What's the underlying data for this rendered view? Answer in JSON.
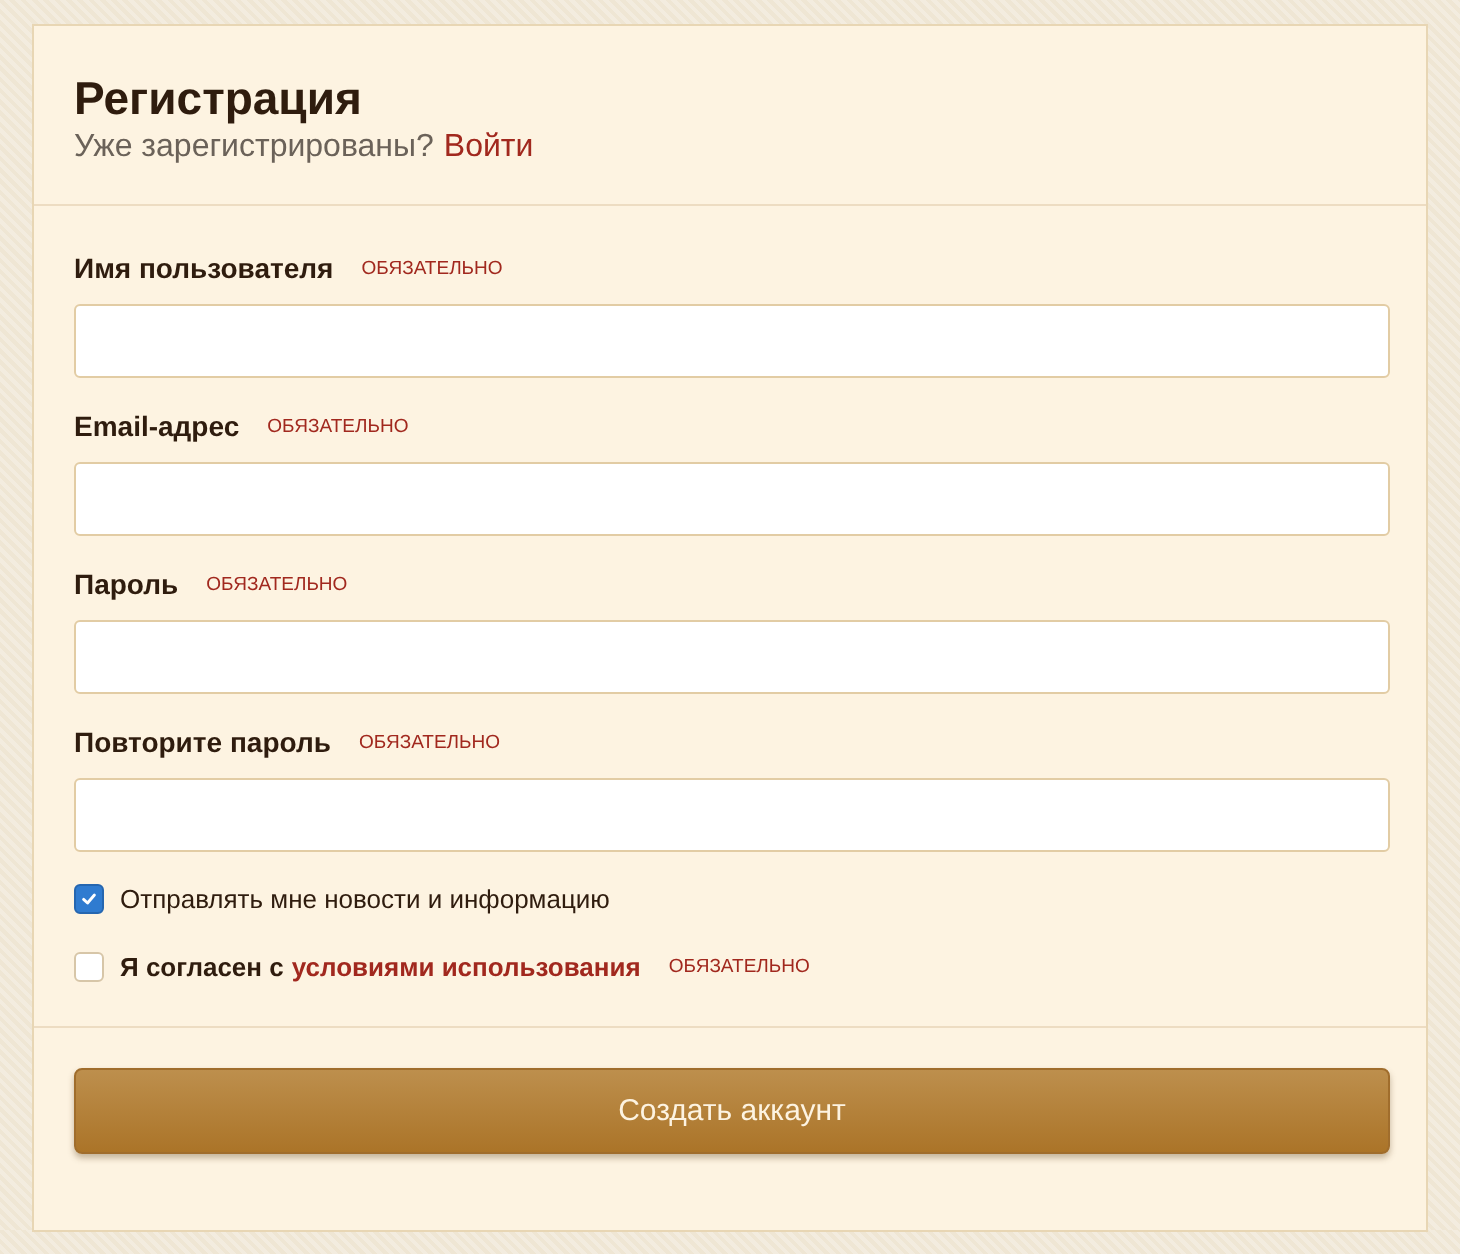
{
  "header": {
    "title": "Регистрация",
    "subtitle": "Уже зарегистрированы?",
    "login_link": "Войти"
  },
  "fields": [
    {
      "label": "Имя пользователя",
      "required_tag": "ОБЯЗАТЕЛЬНО"
    },
    {
      "label": "Email-адрес",
      "required_tag": "ОБЯЗАТЕЛЬНО"
    },
    {
      "label": "Пароль",
      "required_tag": "ОБЯЗАТЕЛЬНО"
    },
    {
      "label": "Повторите пароль",
      "required_tag": "ОБЯЗАТЕЛЬНО"
    }
  ],
  "checkboxes": [
    {
      "kind": "plain",
      "label": "Отправлять мне новости и информацию",
      "checked": true
    },
    {
      "kind": "terms",
      "label": "Я согласен с",
      "link": "условиями использования",
      "required_tag": "ОБЯЗАТЕЛЬНО",
      "checked": false
    }
  ],
  "submit": {
    "label": "Создать аккаунт"
  }
}
